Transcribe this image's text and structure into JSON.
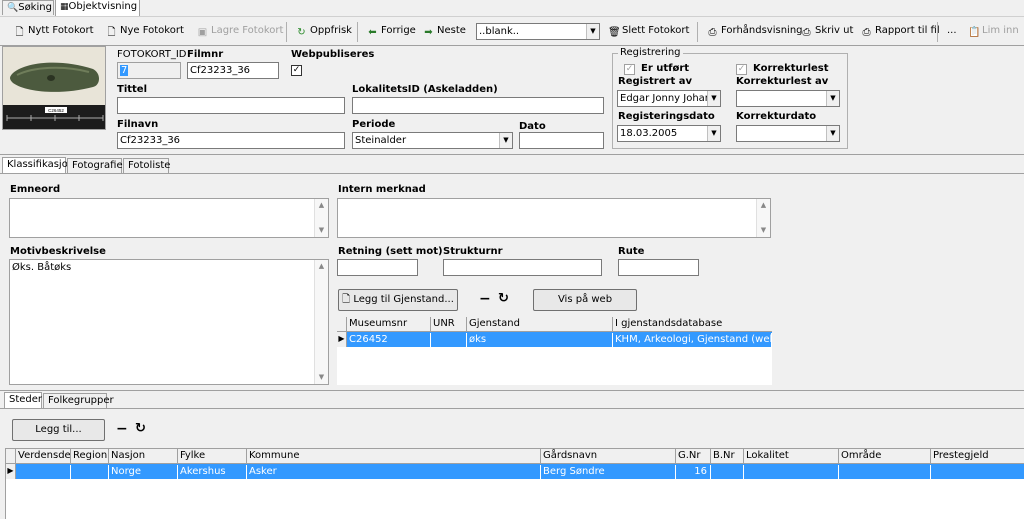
{
  "tabs_top": [
    "Søking",
    "Objektvisning"
  ],
  "toolbar": {
    "new_photocard": "Nytt Fotokort",
    "new_photocards": "Nye Fotokort",
    "save_photocard": "Lagre Fotokort",
    "refresh": "Oppfrisk",
    "previous": "Forrige",
    "next": "Neste",
    "blank_combo": "..blank..",
    "delete_photocard": "Slett Fotokort",
    "preview": "Forhåndsvisning",
    "print": "Skriv ut",
    "report_to_file": "Rapport til fil",
    "more": "...",
    "paste": "Lim inn"
  },
  "form": {
    "fotokort_id_label": "FOTOKORT_ID",
    "fotokort_id_value": "7",
    "filmnr_label": "Filmnr",
    "filmnr_value": "Cf23233_36",
    "webpubliseres_label": "Webpubliseres",
    "webpubliseres_checked": "✓",
    "tittel_label": "Tittel",
    "tittel_value": "",
    "lokalitetsid_label": "LokalitetsID (Askeladden)",
    "lokalitetsid_value": "",
    "filnavn_label": "Filnavn",
    "filnavn_value": "Cf23233_36",
    "periode_label": "Periode",
    "periode_value": "Steinalder",
    "dato_label": "Dato",
    "dato_value": "",
    "photo_caption": "C26452"
  },
  "registrering": {
    "title": "Registrering",
    "er_utfort_label": "Er utført",
    "er_utfort_checked": "✓",
    "korrekturlest_label": "Korrekturlest",
    "korrekturlest_checked": "✓",
    "registrert_av_label": "Registrert av",
    "registrert_av_value": "Edgar Jonny Johansen",
    "korrekturlest_av_label": "Korrekturlest av",
    "korrekturlest_av_value": "",
    "registeringsdato_label": "Registeringsdato",
    "registeringsdato_value": "18.03.2005",
    "korrekturdato_label": "Korrekturdato",
    "korrekturdato_value": ""
  },
  "tabs_mid": [
    "Klassifikasjon",
    "Fotografier",
    "Fotoliste"
  ],
  "klass": {
    "emneord_label": "Emneord",
    "emneord_value": "",
    "intern_merknad_label": "Intern merknad",
    "intern_merknad_value": "",
    "motivbeskrivelse_label": "Motivbeskrivelse",
    "motivbeskrivelse_value": "Øks. Båtøks",
    "retning_label": "Retning (sett mot)",
    "retning_value": "",
    "strukturnr_label": "Strukturnr",
    "strukturnr_value": "",
    "rute_label": "Rute",
    "rute_value": "",
    "legg_til_gjenstand": "Legg til Gjenstand...",
    "minus": "−",
    "refresh": "↻",
    "vis_pa_web": "Vis på web"
  },
  "gjenstand_grid": {
    "headers": [
      "Museumsnr",
      "UNR",
      "Gjenstand",
      "I gjenstandsdatabase"
    ],
    "rows": [
      [
        "C26452",
        "",
        "øks",
        "KHM, Arkeologi, Gjenstand (web)"
      ]
    ]
  },
  "tabs_bottom": [
    "Steder",
    "Folkegrupper"
  ],
  "steder": {
    "legg_til": "Legg til...",
    "minus": "−",
    "refresh": "↻",
    "headers": [
      "Verdensdel",
      "Region",
      "Nasjon",
      "Fylke",
      "Kommune",
      "Gårdsnavn",
      "G.Nr",
      "B.Nr",
      "Lokalitet",
      "Område",
      "Prestegjeld"
    ],
    "rows": [
      [
        "",
        "",
        "Norge",
        "Akershus",
        "Asker",
        "Berg Søndre",
        "16",
        "",
        "",
        "",
        ""
      ]
    ]
  },
  "colors": {
    "selection": "#3399ff",
    "background": "#f0f0f0"
  }
}
